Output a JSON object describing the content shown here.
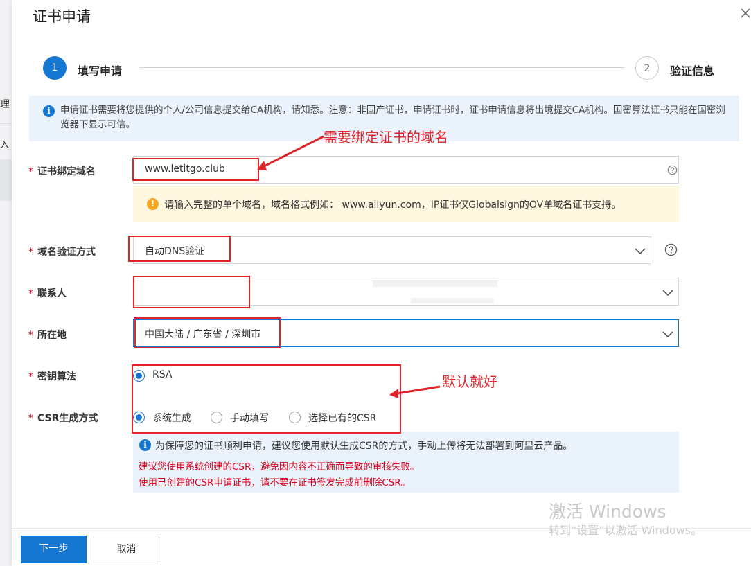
{
  "background": {
    "frag1": "理",
    "frag2": "入"
  },
  "dialog": {
    "title": "证书申请"
  },
  "steps": [
    {
      "number": "1",
      "label": "填写申请"
    },
    {
      "number": "2",
      "label": "验证信息"
    }
  ],
  "notice": "申请证书需要将您提供的个人/公司信息提交给CA机构，请知悉。注意：非国产证书，申请证书时，证书申请信息将出境提交CA机构。国密算法证书只能在国密浏览器下显示可信。",
  "form": {
    "required_mark": "*",
    "domain": {
      "label": "证书绑定域名",
      "value": "www.letitgo.club",
      "hint": "请输入完整的单个域名，域名格式例如： www.aliyun.com，IP证书仅Globalsign的OV单域名证书支持。"
    },
    "verify_method": {
      "label": "域名验证方式",
      "value": "自动DNS验证"
    },
    "contact": {
      "label": "联系人",
      "value": ""
    },
    "location": {
      "label": "所在地",
      "value": "中国大陆 / 广东省 / 深圳市"
    },
    "key_algorithm": {
      "label": "密钥算法",
      "options": [
        "RSA"
      ],
      "selected": "RSA"
    },
    "csr_method": {
      "label": "CSR生成方式",
      "options": [
        "系统生成",
        "手动填写",
        "选择已有的CSR"
      ],
      "selected": "系统生成"
    },
    "csr_notice": {
      "line1": "为保障您的证书顺利申请，建议您使用默认生成CSR的方式，手动上传将无法部署到阿里云产品。",
      "line2": "建议您使用系统创建的CSR，避免因内容不正确而导致的审核失败。",
      "line3": "使用已创建的CSR申请证书，请不要在证书签发完成前删除CSR。"
    }
  },
  "annotations": {
    "domain_note": "需要绑定证书的域名",
    "default_note": "默认就好"
  },
  "footer": {
    "next_label": "下一步",
    "cancel_label": "取消"
  },
  "watermark": {
    "line1": "激活 Windows",
    "line2": "转到“设置”以激活 Windows。"
  },
  "colors": {
    "primary": "#1677d2",
    "annotation_red": "#e0242a",
    "required_red": "#d9001b",
    "warning_bg": "#fff8e0",
    "info_bg": "#eaf2fb"
  }
}
